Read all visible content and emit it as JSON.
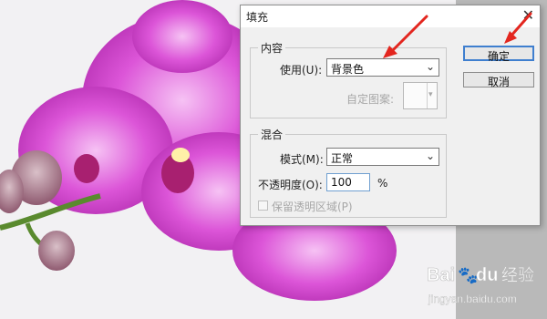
{
  "dialog": {
    "title": "填充",
    "close_glyph": "✕",
    "content_group": {
      "legend": "内容",
      "use_label": "使用(U):",
      "use_value": "背景色",
      "custom_pattern_label": "自定图案:"
    },
    "blend_group": {
      "legend": "混合",
      "mode_label": "模式(M):",
      "mode_value": "正常",
      "opacity_label": "不透明度(O):",
      "opacity_value": "100",
      "opacity_unit": "%",
      "preserve_transparency_label": "保留透明区域(P)",
      "preserve_transparency_checked": false
    },
    "buttons": {
      "ok": "确定",
      "cancel": "取消"
    }
  },
  "watermark": {
    "brand_text": "Bai",
    "paw": "🐾",
    "du": "du",
    "sub": "经验",
    "url": "jingyan.baidu.com"
  },
  "colors": {
    "arrow": "#e3261f",
    "orchid": "#c63ac3",
    "focus_border": "#3f7fcf"
  },
  "chevron_glyph": "⌄"
}
